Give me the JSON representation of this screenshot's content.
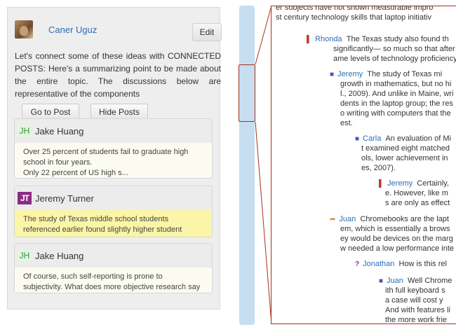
{
  "post": {
    "author": "Caner Uguz",
    "edit_label": "Edit",
    "text": "Let's connect some of these ideas with CONNECTED POSTS: Here's a summarizing point to be made about the entire topic. The discussions below are representative of the components",
    "goto_label": "Go to Post",
    "hide_label": "Hide Posts"
  },
  "connected_posts": [
    {
      "initials": "JH",
      "name": "Jake Huang",
      "text": "Over 25 percent of students fail to graduate high school in four years.",
      "text2": "Only 22 percent of US high s..."
    },
    {
      "initials": "JT",
      "name": "Jeremy Turner",
      "text": "The study of Texas middle school students referenced earlier found slightly higher student growth in..."
    },
    {
      "initials": "JH",
      "name": "Jake Huang",
      "text": "Of course, such self-reporting is prone to subjectivity. What does more objective research say about..."
    }
  ],
  "thread": [
    {
      "text": "er subjects have not shown measurable impro"
    },
    {
      "text": "st century technology skills that laptop initiativ"
    },
    {
      "author": "Rhonda",
      "icon": "red",
      "text": "The Texas study also found th"
    },
    {
      "text": "significantly— so much so that after thr"
    },
    {
      "text": "ame levels of technology proficiency as"
    },
    {
      "author": "Jeremy",
      "icon": "blue",
      "text": "The study of Texas mi"
    },
    {
      "text": "growth in mathematics, but no hi"
    },
    {
      "text": "l., 2009). And unlike in Maine, wri"
    },
    {
      "text": "dents in the laptop group; the res"
    },
    {
      "text": "o writing with computers that the"
    },
    {
      "text": "est."
    },
    {
      "author": "Carla",
      "icon": "blue",
      "text": "An evaluation of Mi"
    },
    {
      "text": "t examined eight matched"
    },
    {
      "text": "ols, lower achievement in"
    },
    {
      "text": "es, 2007)."
    },
    {
      "author": "Jeremy",
      "icon": "red",
      "text": "Certainly,"
    },
    {
      "text": "e. However, like m"
    },
    {
      "text": "s are only as effect"
    },
    {
      "author": "Juan",
      "icon": "orange",
      "text": "Chromebooks are the lapt"
    },
    {
      "text": "em, which is essentially a brows"
    },
    {
      "text": "ey would be devices on the marg"
    },
    {
      "text": "w needed a low performance inte"
    },
    {
      "author": "Jonathan",
      "icon": "purple",
      "text": "How is this rel"
    },
    {
      "author": "Juan",
      "icon": "blue",
      "text": "Well Chrome"
    },
    {
      "text": "ith full keyboard s"
    },
    {
      "text": "a case will cost y"
    },
    {
      "text": "And with features li"
    },
    {
      "text": "the more work frie"
    }
  ],
  "icons": {
    "red": "flag-icon",
    "blue": "comment-icon",
    "orange": "share-arrow-icon",
    "purple": "question-icon"
  },
  "colors": {
    "link": "#2a6fb6",
    "highlight": "#fbf5a8",
    "frame": "#a4321b",
    "scrollbar": "#c7ddf0"
  }
}
